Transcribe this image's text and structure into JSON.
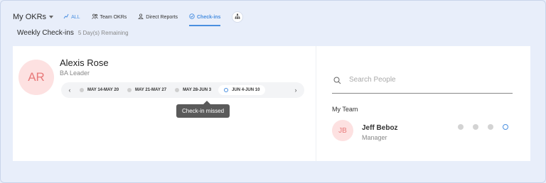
{
  "nav": {
    "title": "My OKRs",
    "tabs": [
      {
        "label": "ALL",
        "icon": "chart-icon"
      },
      {
        "label": "Team OKRs",
        "icon": "team-icon"
      },
      {
        "label": "Direct Reports",
        "icon": "person-icon"
      },
      {
        "label": "Check-ins",
        "icon": "checkin-icon"
      }
    ],
    "org_icon": "org-chart-icon"
  },
  "subheader": {
    "title": "Weekly Check-ins",
    "remaining": "5 Day(s) Remaining"
  },
  "employee": {
    "initials": "AR",
    "name": "Alexis Rose",
    "role": "BA Leader"
  },
  "weeks": {
    "prev": "‹",
    "next": "›",
    "items": [
      {
        "label": "MAY 14-MAY 20"
      },
      {
        "label": "MAY 21-MAY 27"
      },
      {
        "label": "MAY 28-JUN 3"
      },
      {
        "label": "JUN 4-JUN 10"
      }
    ]
  },
  "tooltip": "Check-in missed",
  "search": {
    "placeholder": "Search People",
    "value": ""
  },
  "team": {
    "label": "My Team",
    "members": [
      {
        "initials": "JB",
        "name": "Jeff Beboz",
        "role": "Manager"
      }
    ]
  },
  "colors": {
    "accent": "#4a8fe0",
    "avatar_bg": "#fde1e1",
    "avatar_text": "#e87a7a",
    "page_bg": "#e8eefa"
  }
}
